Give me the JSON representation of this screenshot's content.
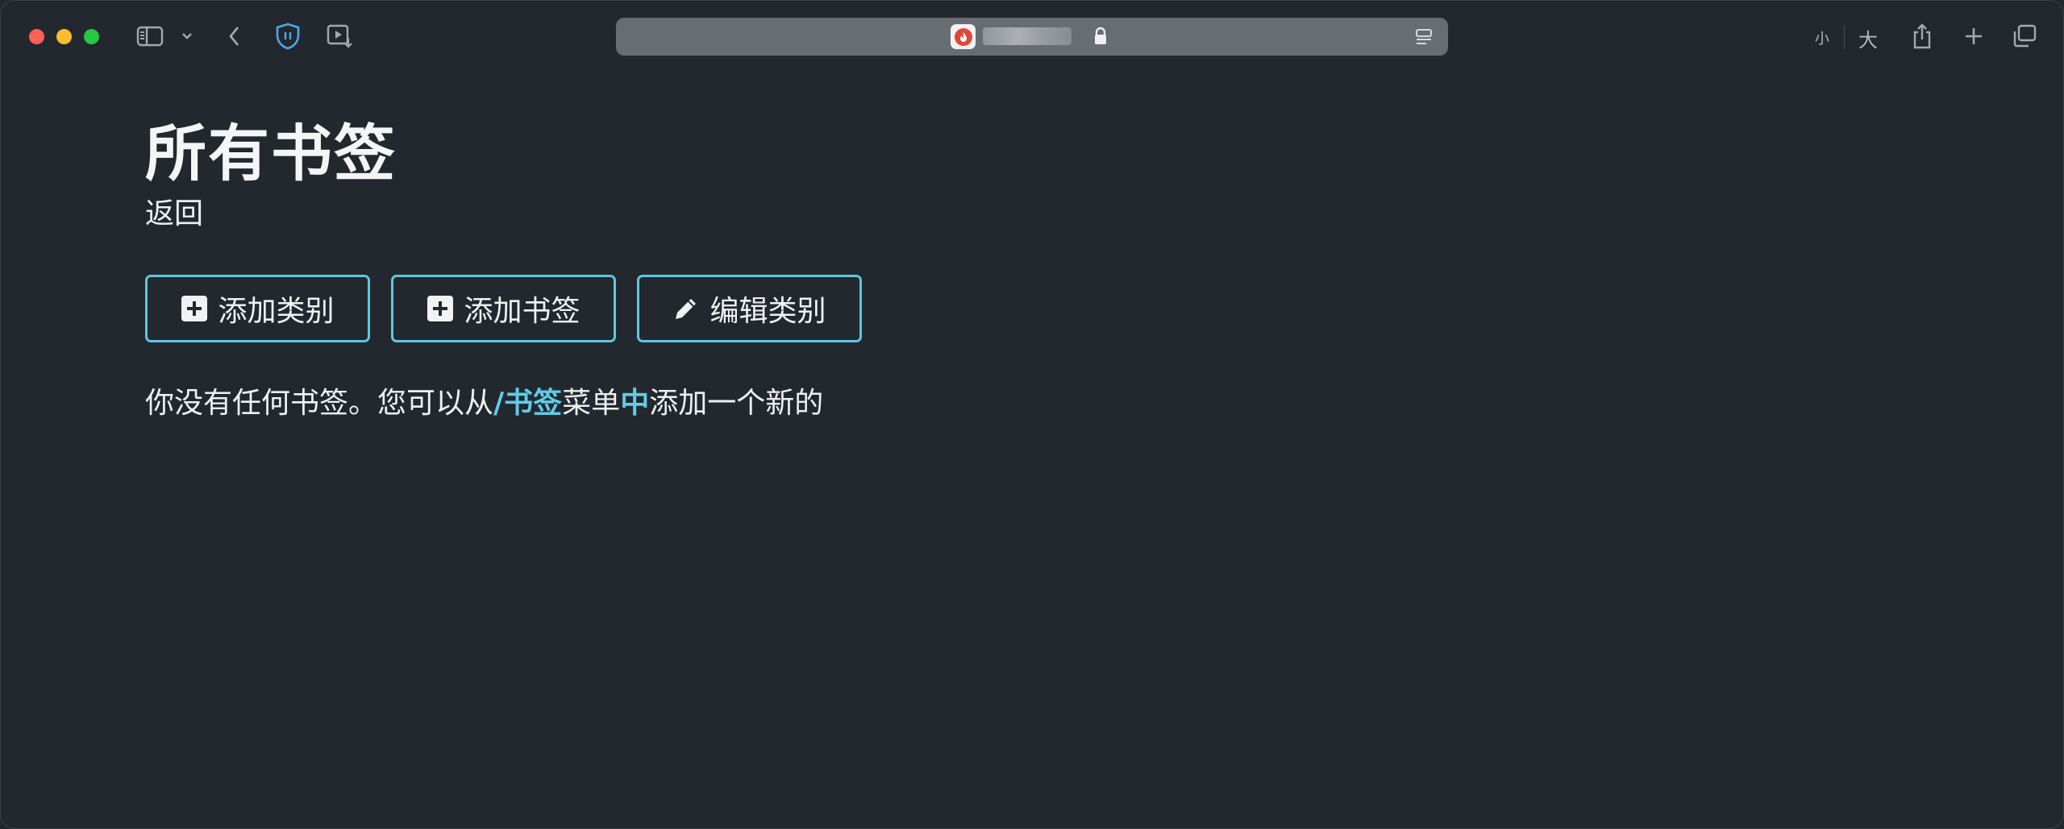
{
  "toolbar": {
    "text_size_small": "小",
    "text_size_large": "大"
  },
  "page": {
    "title": "所有书签",
    "back_label": "返回"
  },
  "buttons": {
    "add_category": "添加类别",
    "add_bookmark": "添加书签",
    "edit_category": "编辑类别"
  },
  "empty_message": {
    "part1": "你没有任何书签。您可以从",
    "link1": "/书签",
    "part2": "菜单",
    "link2": "中",
    "part3": "添加一个新的"
  },
  "colors": {
    "background": "#23282f",
    "accent": "#5cc8e0",
    "address_bar": "#686d74"
  }
}
